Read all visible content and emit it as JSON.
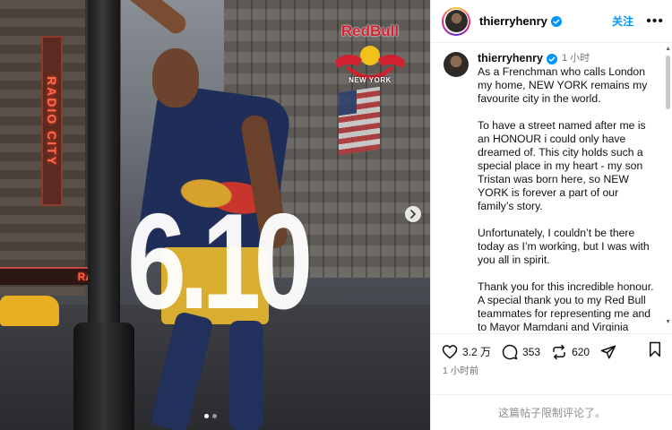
{
  "media": {
    "overlay_date": "6.10",
    "sign_text": "RADIO CITY",
    "marquee_text": "RA",
    "logo": {
      "title": "RedBull",
      "subtitle": "NEW YORK"
    },
    "carousel": {
      "slide_count": 2,
      "active_index": 0
    }
  },
  "header": {
    "username": "thierryhenry",
    "follow_label": "关注",
    "more_label": "•••"
  },
  "caption": {
    "username": "thierryhenry",
    "time": "1 小时",
    "paragraphs": [
      "As a Frenchman who calls London my home, NEW YORK remains my favourite city in the world.",
      "To have a street named after me is an HONOUR i could only have dreamed of. This city holds such a special place in my heart - my son Tristan was born here, so NEW YORK is forever a part of our family’s story.",
      "Unfortunately, I couldn’t be there today as I’m working, but I was with you all in spirit.",
      "Thank you for this incredible honour. A special thank you to my Red Bull teammates for representing me and to Mayor Mamdani and Virginia Maloney for your kindness and recognition."
    ]
  },
  "actions": {
    "likes": "3.2 万",
    "comments": "353",
    "reposts": "620"
  },
  "timestamp": "1 小时前",
  "comments_disabled": "这篇帖子限制评论了。",
  "colors": {
    "accent": "#0095f6",
    "brand_red": "#d2202f"
  }
}
